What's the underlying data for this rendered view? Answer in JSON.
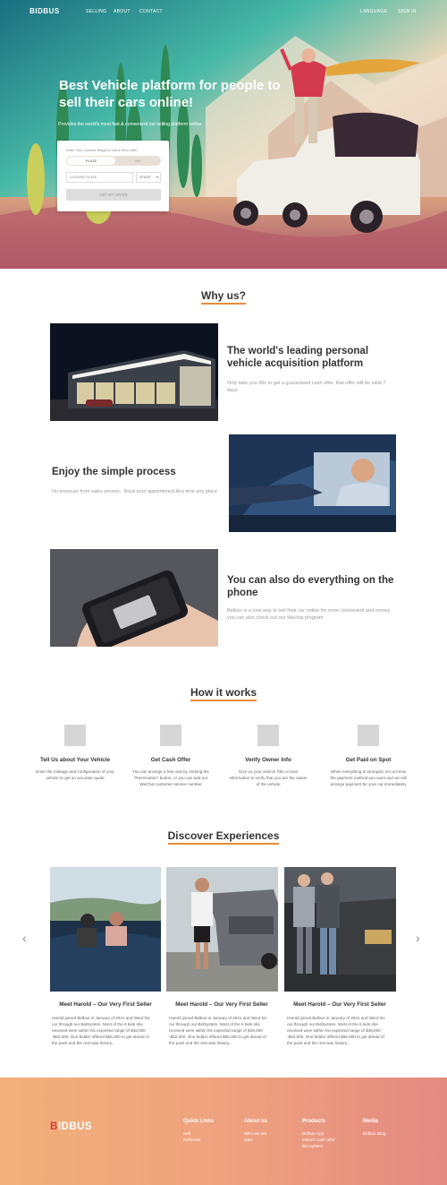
{
  "nav": {
    "logo": "BIDBUS",
    "links": [
      "SELLING",
      "ABOUT",
      "CONTACT"
    ],
    "language": "LANGUAGE",
    "signin": "SIGN IN"
  },
  "hero": {
    "title": "Best Vehicle platform for people to sell their cars online!",
    "subtitle": "Provides the world's most fast & convenient car selling platform online",
    "form": {
      "hint": "Enter Your License Plage to Get a Real Offer",
      "toggle_plate": "PLATE",
      "toggle_vin": "VIN",
      "plate_placeholder": "LICENSE PLATE",
      "state_placeholder": "STATE",
      "submit": "GET MY OFFER"
    }
  },
  "why_us": {
    "title": "Why us?",
    "features": [
      {
        "title": "The world's leading personal vehicle acquisition platform",
        "desc": "Only take you 45s to get a guaranteed cash offer, that offer will be valid 7 days"
      },
      {
        "title": "Enjoy the simple process",
        "desc": "No pressure from sales person。Book your appointment Any time any place"
      },
      {
        "title": "You can also do everything on the phone",
        "desc": "Bidbus is a new way to sell their car online for more convenient and money you can also check out our Wechat program"
      }
    ]
  },
  "how_it_works": {
    "title": "How it works",
    "steps": [
      {
        "title": "Tell Us about Your Vehicle",
        "desc": "Enter the mileage and configuration of your vehicle to get an accurate quote"
      },
      {
        "title": "Get Cash Offer",
        "desc": "You can arrange a free visit by clicking the \"Reservation\" button, or you can add our WeChat customer service number"
      },
      {
        "title": "Verify Owner Info",
        "desc": "Give us your vehicle Title or loan information to verify that you are the owner of the vehicle"
      },
      {
        "title": "Get Paid on Spot",
        "desc": "When everything is arranged, let us know the payment method you want and we will arrange payment for your car immediately"
      }
    ]
  },
  "discover": {
    "title": "Discover Experiences",
    "cards": [
      {
        "title": "Meet Harold – Our Very First Seller",
        "desc": "Harold joined Bidbus in January of 2021 and listed his car through our BidSystem. Most of the 6 bids she received were within his expected range of $48,000 -$52,000. One bidder offered $56,000 to get ahead of the pack and the rest was history..."
      },
      {
        "title": "Meet Harold – Our Very First Seller",
        "desc": "Harold joined Bidbus in January of 2021 and listed his car through our BidSystem. Most of the 6 bids she received were within his expected range of $48,000 -$52,000. One bidder offered $56,000 to get ahead of the pack and the rest was history..."
      },
      {
        "title": "Meet Harold – Our Very First Seller",
        "desc": "Harold joined Bidbus in January of 2021 and listed his car through our BidSystem. Most of the 6 bids she received were within his expected range of $48,000 -$52,000. One bidder offered $56,000 to get ahead of the pack and the rest was history..."
      }
    ],
    "prev_icon": "chevron-left-icon",
    "next_icon": "chevron-right-icon"
  },
  "footer": {
    "logo_first": "B",
    "logo_rest": "IDBUS",
    "columns": [
      {
        "title": "Quick Links",
        "links": [
          "Sell",
          "Referrals"
        ]
      },
      {
        "title": "About us",
        "links": [
          "Who we are",
          "Q&A"
        ]
      },
      {
        "title": "Products",
        "links": [
          "Bidbus App",
          "Instant cash offer",
          "Bid system"
        ]
      },
      {
        "title": "Media",
        "links": [
          "Bidbus Blog"
        ]
      }
    ]
  },
  "colors": {
    "accent": "#e88a3d",
    "footer_start": "#f1b07a",
    "footer_end": "#e38a82",
    "logo_red": "#d73b2f"
  }
}
